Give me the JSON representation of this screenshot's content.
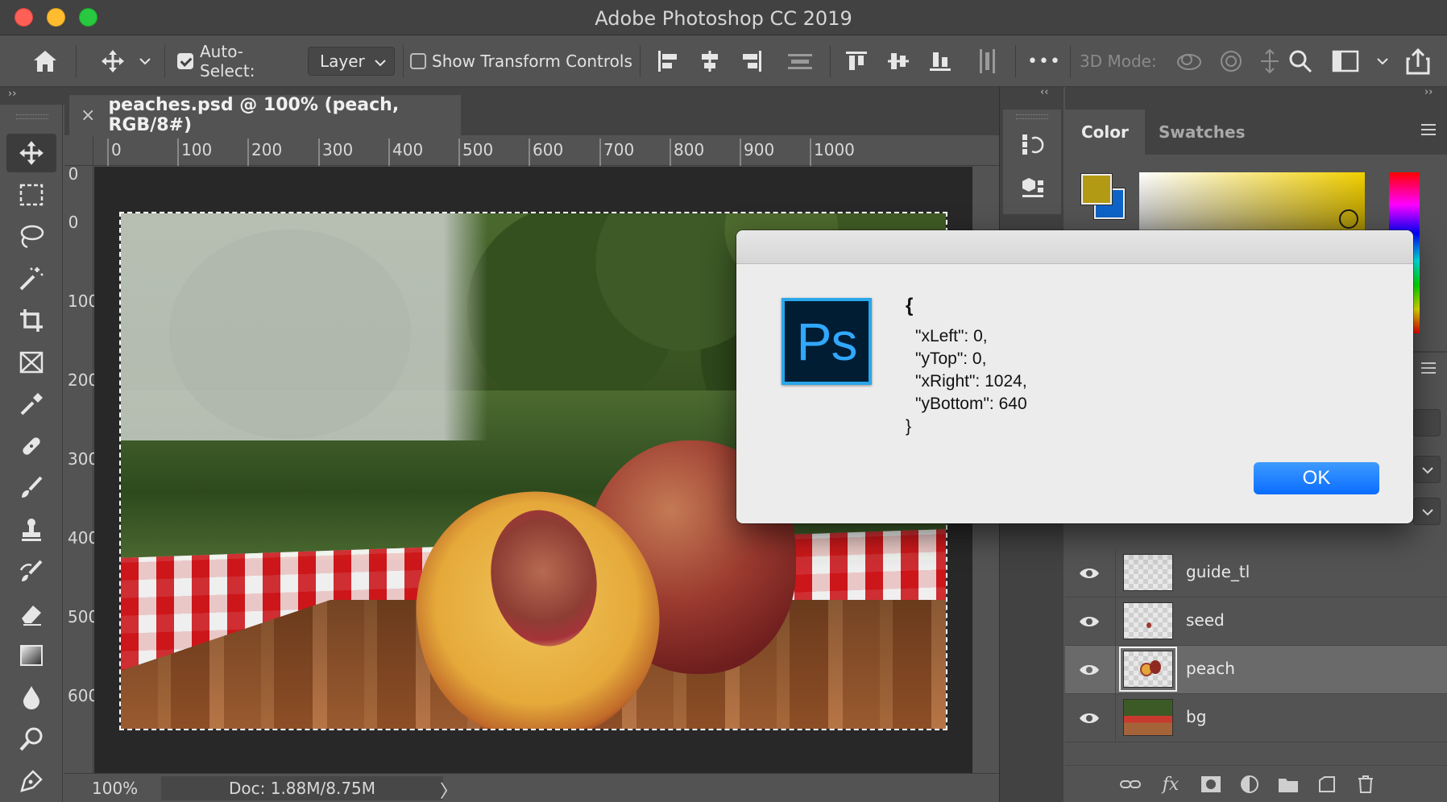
{
  "window": {
    "title": "Adobe Photoshop CC 2019"
  },
  "options_bar": {
    "auto_select_label": "Auto-Select:",
    "auto_select_checked": true,
    "auto_select_target": "Layer",
    "show_transform_label": "Show Transform Controls",
    "show_transform_checked": false,
    "more_label": "•••",
    "mode_3d_label": "3D Mode:"
  },
  "document": {
    "tab_title": "peaches.psd @ 100% (peach, RGB/8#)",
    "close_glyph": "×",
    "ruler_h": [
      "0",
      "100",
      "200",
      "300",
      "400",
      "500",
      "600",
      "700",
      "800",
      "900",
      "1000"
    ],
    "ruler_v": [
      "0",
      "0",
      "100",
      "200",
      "300",
      "400",
      "500",
      "600"
    ]
  },
  "status_bar": {
    "zoom": "100%",
    "doc_size": "Doc: 1.88M/8.75M",
    "arrow": "〉"
  },
  "color_panel": {
    "tabs": [
      "Color",
      "Swatches"
    ],
    "foreground": "#b39a14",
    "background": "#0d63c7"
  },
  "layers": [
    {
      "name": "guide_tl",
      "visible": true,
      "selected": false
    },
    {
      "name": "seed",
      "visible": true,
      "selected": false
    },
    {
      "name": "peach",
      "visible": true,
      "selected": true
    },
    {
      "name": "bg",
      "visible": true,
      "selected": false
    }
  ],
  "dialog": {
    "logo_text": "Ps",
    "open_brace": "{",
    "lines": [
      "\"xLeft\": 0,",
      "\"yTop\": 0,",
      "\"xRight\": 1024,",
      "\"yBottom\": 640"
    ],
    "close_brace": "}",
    "ok_label": "OK"
  },
  "collapse_glyphs": {
    "left": "››",
    "middle": "‹‹",
    "right": "››"
  },
  "colors": {
    "accent": "#0a6cff",
    "ps_blue": "#31a8ff",
    "ps_dark": "#001d34"
  }
}
